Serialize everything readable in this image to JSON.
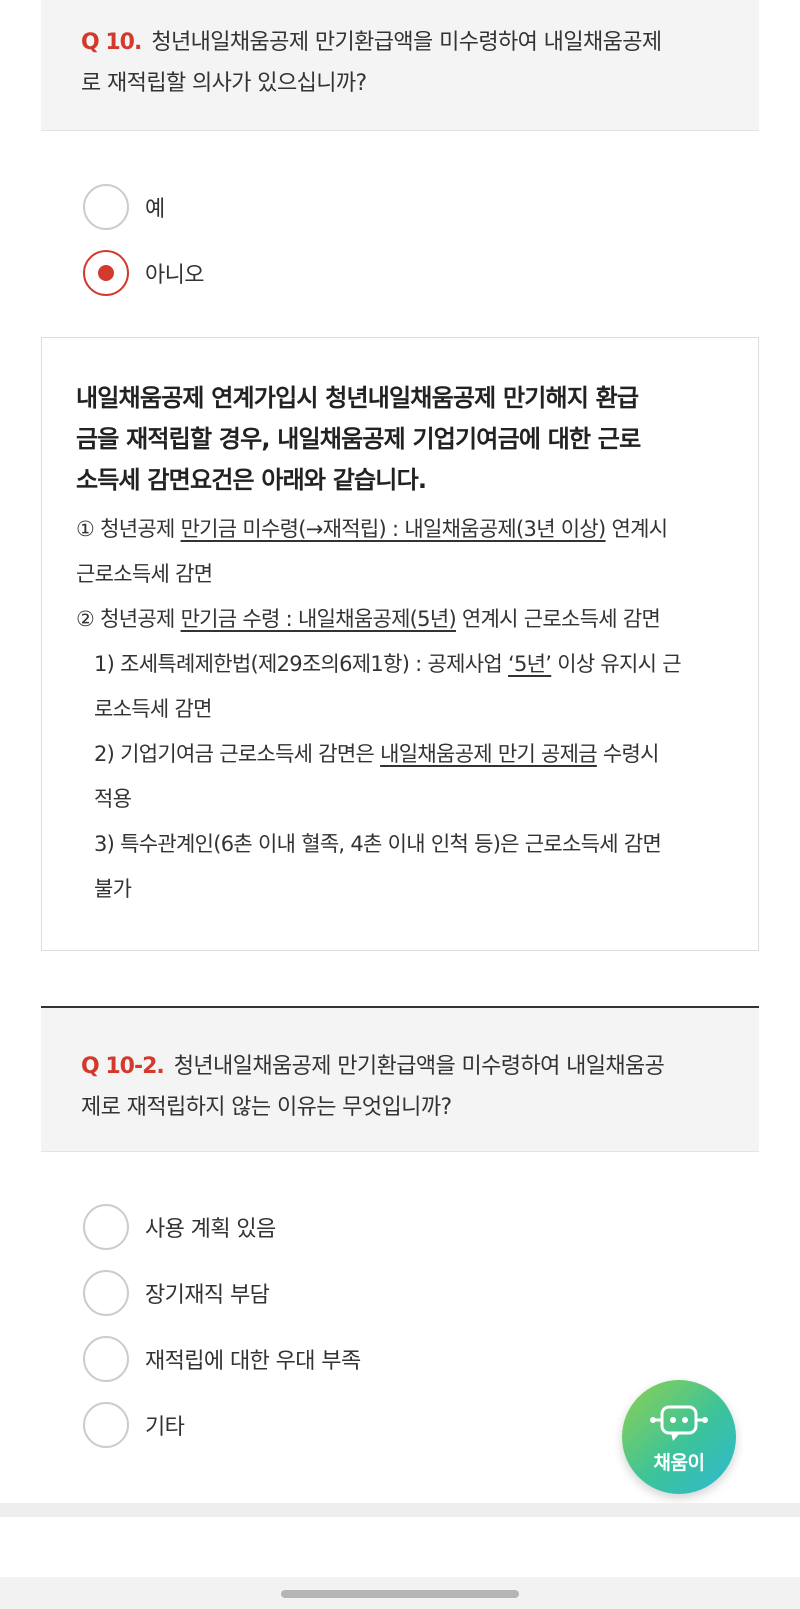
{
  "q10": {
    "number": "Q 10.",
    "text_line1": "청년내일채움공제 만기환급액을 미수령하여 내일채움공제",
    "text_line2": "로 재적립할 의사가 있으십니까?",
    "options": [
      {
        "label": "예",
        "checked": false
      },
      {
        "label": "아니오",
        "checked": true
      }
    ]
  },
  "info": {
    "title_line1": "내일채움공제 연계가입시 청년내일채움공제 만기해지 환급",
    "title_line2": "금을 재적립할 경우, 내일채움공제 기업기여금에 대한 근로",
    "title_line3": "소득세 감면요건은 아래와 같습니다.",
    "item1": {
      "prefix": "① 청년공제 ",
      "u1": "만기금 미수령(→재적립) : 내일채움공제(3년 이상)",
      "suffix": " 연계시",
      "cont": "근로소득세 감면"
    },
    "item2": {
      "prefix": "② 청년공제 ",
      "u1": "만기금 수령 : 내일채움공제(5년)",
      "suffix": " 연계시 근로소득세 감면"
    },
    "sub1": {
      "a": "1) 조세특례제한법(제29조의6제1항) : 공제사업 ",
      "u": "‘5년’",
      "b": " 이상 유지시 근",
      "cont": "로소득세 감면"
    },
    "sub2": {
      "a": "2) 기업기여금 근로소득세 감면은 ",
      "u": "내일채움공제 만기 공제금",
      "b": " 수령시",
      "cont": "적용"
    },
    "sub3": {
      "a": "3) 특수관계인(6촌 이내 혈족, 4촌 이내 인척 등)은 근로소득세 감면",
      "cont": "불가"
    }
  },
  "q102": {
    "number": "Q 10-2.",
    "text_line1": "청년내일채움공제 만기환급액을 미수령하여 내일채움공",
    "text_line2": "제로 재적립하지 않는 이유는 무엇입니까?",
    "options": [
      {
        "label": "사용 계획 있음",
        "checked": false
      },
      {
        "label": "장기재직 부담",
        "checked": false
      },
      {
        "label": "재적립에 대한 우대 부족",
        "checked": false
      },
      {
        "label": "기타",
        "checked": false
      }
    ]
  },
  "chatbot": {
    "label": "채움이",
    "icon": "robot-chat-icon"
  },
  "colors": {
    "accent": "#d33a2e",
    "chatbot_start": "#8fd14f",
    "chatbot_end": "#2db9d4"
  }
}
